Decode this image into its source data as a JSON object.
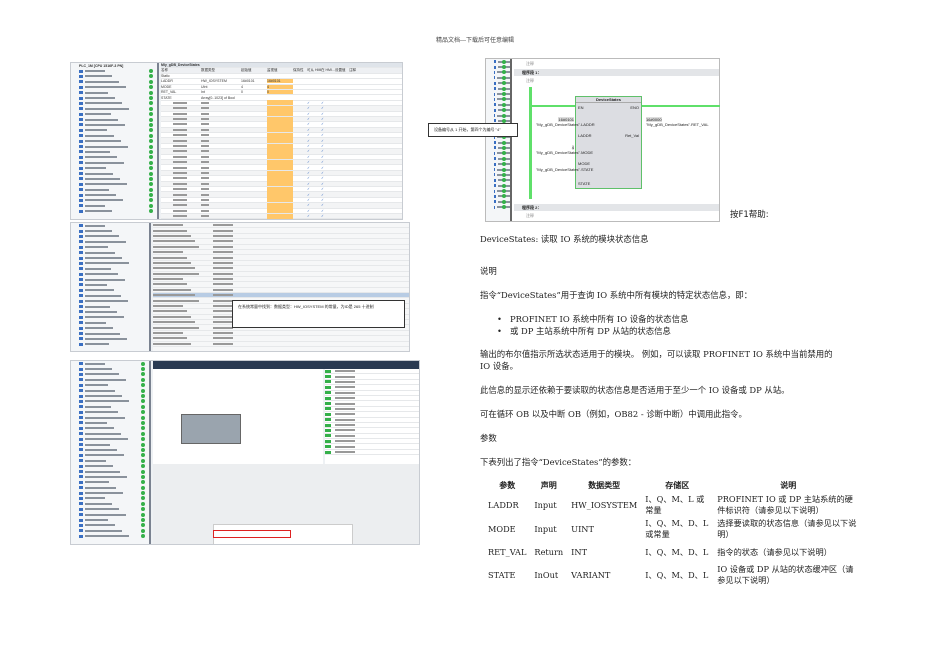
{
  "header": "精品文档---下载后可任意编辑",
  "shot1": {
    "title": "Mly_gDB_DeviceStates",
    "cols": [
      "名称",
      "数据类型",
      "起始值",
      "监视值",
      "保持性",
      "可从 HMI...",
      "在 HMI...",
      "设置值",
      "注释"
    ],
    "rows": [
      [
        "Static",
        "",
        "",
        "",
        ""
      ],
      [
        "LADDR",
        "HW_IOSYSTEM",
        "16#0101",
        "16#0101",
        ""
      ],
      [
        "MODE",
        "UInt",
        "4",
        "4",
        ""
      ],
      [
        "RET_VAL",
        "Int",
        "0",
        "0",
        ""
      ],
      [
        "STATE",
        "Array[0..1023] of Bool",
        "",
        "",
        ""
      ]
    ],
    "tree_root": "PLC_1M [CPU 1516F-3 PN]"
  },
  "shot2": {
    "callout": "在系统常量中找到：数据类型：HW_IOSYSTEM 的常量，为ID是 265 十进制"
  },
  "ladder": {
    "network1": "程序段 1：",
    "network2": "程序段 2：",
    "comment": "注释",
    "block": "DeviceStates",
    "en": "EN",
    "eno": "ENO",
    "laddr_val": "16#0101",
    "laddr_var": "\"My_gDB_DeviceStates\".LADDR",
    "laddr": "LADDR",
    "mode_val": "4",
    "mode_var": "\"My_gDB_DeviceStates\".MODE",
    "mode": "MODE",
    "state_var": "\"My_gDB_DeviceStates\".STATE",
    "state": "STATE",
    "retval_val": "16#0000",
    "retval_var": "\"My_gDB_DeviceStates\".RET_VAL",
    "retval": "Ret_Val",
    "callout": "设备编号从 1 开始，第四个为编号 \"4\"",
    "f1": "按F1帮助:"
  },
  "doc": {
    "title": "DeviceStates:  读取 IO 系统的模块状态信息",
    "h_desc": "说明",
    "p1": "指令“DeviceStates”用于查询 IO 系统中所有模块的特定状态信息，即：",
    "b1": "PROFINET IO 系统中所有 IO 设备的状态信息",
    "b2": "或 DP 主站系统中所有 DP 从站的状态信息",
    "p2a": "输出的布尔值指示所选状态适用于的模块。 例如，可以读取 PROFINET IO 系统中当前禁用的",
    "p2b": "IO 设备。",
    "p3": "此信息的显示还依赖于要读取的状态信息是否适用于至少一个 IO 设备或 DP 从站。",
    "p4": "可在循环 OB 以及中断 OB（例如，OB82 - 诊断中断）中调用此指令。",
    "h_params": "参数",
    "p5": "下表列出了指令“DeviceStates”的参数：",
    "table": {
      "headers": [
        "参数",
        "声明",
        "数据类型",
        "存储区",
        "说明"
      ],
      "rows": [
        [
          "LADDR",
          "Input",
          "HW_IOSYSTEM",
          "I、Q、M、L 或常量",
          "PROFINET IO 或 DP 主站系统的硬件标识符（请参见以下说明）"
        ],
        [
          "MODE",
          "Input",
          "UINT",
          "I、Q、M、D、L 或常量",
          "选择要读取的状态信息（请参见以下说明）"
        ],
        [
          "RET_VAL",
          "Return",
          "INT",
          "I、Q、M、D、L",
          "指令的状态（请参见以下说明）"
        ],
        [
          "STATE",
          "InOut",
          "VARIANT",
          "I、Q、M、D、L",
          "IO 设备或 DP 从站的状态缓冲区（请参见以下说明）"
        ]
      ]
    }
  }
}
